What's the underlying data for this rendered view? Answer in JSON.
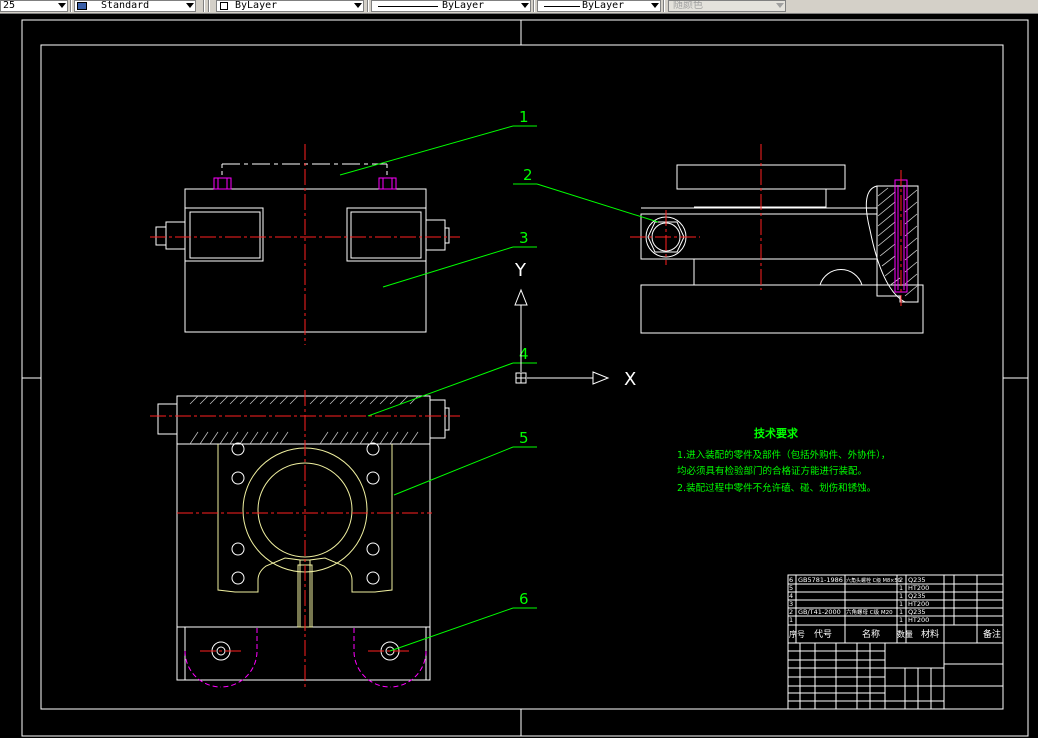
{
  "toolbar": {
    "textstyle_partial": "25",
    "dimstyle_value": "Standard",
    "layer_value": "ByLayer",
    "linetype_value": "ByLayer",
    "lineweight_value": "ByLayer",
    "plotstyle_value": "随颜色"
  },
  "drawing": {
    "balloons": [
      "1",
      "2",
      "3",
      "4",
      "5",
      "6"
    ],
    "ucs": {
      "y_label": "Y",
      "x_label": "X"
    },
    "tech_requirements": {
      "title": "技术要求",
      "line1": "1.进入装配的零件及部件（包括外购件、外协件），",
      "line2": "均必须具有检验部门的合格证方能进行装配。",
      "line3": "2.装配过程中零件不允许磕、碰、划伤和锈蚀。"
    },
    "bom": {
      "rows": [
        [
          "6",
          "GB5781-1986",
          "六角头螺栓 C级 M8×50",
          "2",
          "Q235"
        ],
        [
          "5",
          "",
          "",
          "1",
          "HT200"
        ],
        [
          "4",
          "",
          "",
          "1",
          "Q235"
        ],
        [
          "3",
          "",
          "",
          "1",
          "HT200"
        ],
        [
          "2",
          "GB/T41-2000",
          "六角螺母 C级 M20",
          "1",
          "Q235"
        ],
        [
          "1",
          "",
          "",
          "1",
          "HT200"
        ]
      ],
      "header": {
        "seq": "序号",
        "code": "代号",
        "name": "名称",
        "qty": "数量",
        "material": "材料",
        "note": "备注"
      }
    }
  }
}
